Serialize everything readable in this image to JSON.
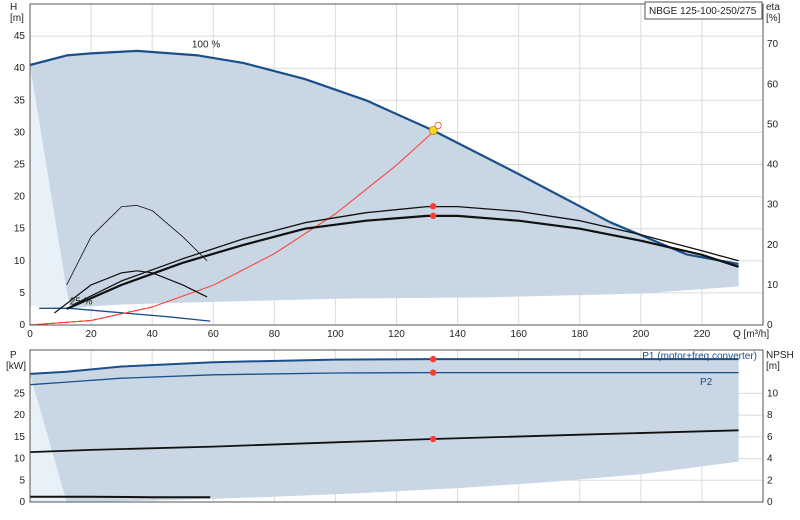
{
  "colors": {
    "envelope": "#c9d6e3",
    "envelope_light": "#e8f0f8",
    "curve_blue": "#1a4f8c",
    "curve_black": "#111111",
    "system_red": "#ff3b30",
    "duty_yellow": "#ffd21f",
    "grid": "#dcdcdc"
  },
  "chart_data": [
    {
      "type": "line",
      "title": "NBGE 125-100-250/275",
      "xlabel": "Q [m³/h]",
      "ylabel": "H [m]",
      "ylabel_unit": "[m]",
      "ylabel_name": "H",
      "y2label_name": "eta",
      "y2label_unit": "[%]",
      "xlim": [
        0,
        240
      ],
      "ylim": [
        0,
        50
      ],
      "y2lim": [
        0,
        80
      ],
      "xticks": [
        0,
        20,
        40,
        60,
        80,
        100,
        120,
        140,
        160,
        180,
        200,
        220
      ],
      "yticks": [
        0,
        5,
        10,
        15,
        20,
        25,
        30,
        35,
        40,
        45
      ],
      "y2ticks": [
        0,
        10,
        20,
        30,
        40,
        50,
        60,
        70
      ],
      "grid": true,
      "annotations": [
        {
          "text": "100 %",
          "x": 53,
          "y": 43.2
        },
        {
          "text": "25 %",
          "x": 13,
          "y": 3.2
        }
      ],
      "envelope": {
        "upper_x": [
          0,
          12,
          20,
          35,
          55,
          70,
          90,
          110,
          132,
          160,
          190,
          215,
          232
        ],
        "upper_y": [
          40.5,
          42,
          42.3,
          42.7,
          42,
          40.8,
          38.3,
          35,
          30.3,
          23.5,
          16,
          11,
          9.5
        ],
        "lower_x": [
          232,
          200,
          150,
          100,
          60,
          30,
          20,
          13
        ],
        "lower_y": [
          6,
          4.9,
          4.3,
          4.1,
          3.6,
          3.2,
          2.9,
          2.6
        ]
      },
      "series": [
        {
          "role": "head_max",
          "x": [
            0,
            12,
            20,
            35,
            55,
            70,
            90,
            110,
            132,
            160,
            190,
            215,
            232
          ],
          "y": [
            40.5,
            42,
            42.3,
            42.7,
            42,
            40.8,
            38.3,
            35,
            30.3,
            23.5,
            16,
            11,
            9.5
          ]
        },
        {
          "role": "head_min",
          "x": [
            3,
            13,
            30,
            45,
            59
          ],
          "y": [
            2.6,
            2.6,
            1.9,
            1.3,
            0.6
          ]
        },
        {
          "role": "system",
          "x": [
            0,
            20,
            40,
            60,
            80,
            100,
            120,
            133
          ],
          "y": [
            0,
            0.7,
            2.8,
            6.2,
            11.1,
            17.3,
            24.9,
            30.5
          ]
        },
        {
          "role": "eta_thin_1",
          "x": [
            12,
            20,
            30,
            35,
            40,
            50,
            58
          ],
          "y2": [
            10,
            22,
            29.5,
            29.8,
            28.5,
            22,
            16
          ]
        },
        {
          "role": "eta_thin_2",
          "x": [
            8,
            20,
            30,
            35,
            40,
            50,
            58
          ],
          "y2": [
            3,
            10,
            13,
            13.5,
            13,
            10,
            7
          ]
        },
        {
          "role": "eta_upper",
          "x": [
            14,
            30,
            50,
            70,
            90,
            110,
            130,
            140,
            160,
            180,
            200,
            220,
            232
          ],
          "y2": [
            5,
            11,
            16.5,
            21.5,
            25.5,
            28,
            29.5,
            29.5,
            28.3,
            26,
            22.5,
            18.5,
            16
          ]
        },
        {
          "role": "eta_lower",
          "x": [
            12,
            30,
            50,
            70,
            90,
            110,
            130,
            140,
            160,
            180,
            200,
            220,
            232
          ],
          "y2": [
            4,
            10,
            15.5,
            20,
            24,
            26,
            27.2,
            27.2,
            26,
            24,
            21,
            17.5,
            14.5
          ]
        }
      ],
      "duty_point": {
        "x": 132,
        "y": 30.3
      },
      "duty_markers_y2": [
        {
          "x": 132,
          "y2": 29.6
        },
        {
          "x": 132,
          "y2": 27.2
        }
      ]
    },
    {
      "type": "line",
      "xlim": [
        0,
        240
      ],
      "ylim": [
        0,
        35
      ],
      "y2lim": [
        0,
        14
      ],
      "ylabel_name": "P",
      "ylabel_unit": "[kW]",
      "y2label_name": "NPSH",
      "y2label_unit": "[m]",
      "yticks": [
        0,
        5,
        10,
        15,
        20,
        25
      ],
      "y2ticks": [
        0,
        2,
        4,
        6,
        8,
        10
      ],
      "grid": true,
      "legend": [
        {
          "text": "P1 (motor+freq.converter)",
          "placement": "top-right"
        },
        {
          "text": "P2",
          "placement": "right"
        }
      ],
      "envelope": {
        "upper_x": [
          0,
          12,
          30,
          60,
          100,
          132,
          180,
          232
        ],
        "upper_y": [
          29.5,
          30,
          31.2,
          32.2,
          32.8,
          32.9,
          32.9,
          32.9
        ],
        "lower_x": [
          232,
          200,
          170,
          140,
          110,
          80,
          50,
          25,
          12
        ],
        "lower_y": [
          9.3,
          6.4,
          4.6,
          3.2,
          2.1,
          1.2,
          0.5,
          0.1,
          0
        ]
      },
      "series": [
        {
          "name": "P1 (motor+freq.converter)",
          "x": [
            0,
            12,
            30,
            60,
            100,
            132,
            180,
            232
          ],
          "y": [
            29.5,
            30,
            31.2,
            32.2,
            32.8,
            32.9,
            32.9,
            32.9
          ]
        },
        {
          "name": "P2",
          "x": [
            0,
            12,
            30,
            60,
            100,
            132,
            180,
            232
          ],
          "y": [
            27,
            27.6,
            28.5,
            29.3,
            29.7,
            29.8,
            29.8,
            29.8
          ]
        },
        {
          "role": "npsh",
          "x": [
            0,
            20,
            60,
            100,
            132,
            180,
            232
          ],
          "y2": [
            4.6,
            4.8,
            5.1,
            5.5,
            5.8,
            6.2,
            6.6
          ]
        },
        {
          "role": "p_min",
          "x": [
            0,
            20,
            40,
            59
          ],
          "y": [
            1.2,
            1.2,
            1.1,
            1.1
          ]
        }
      ],
      "duty_markers": [
        {
          "x": 132,
          "y": 32.9
        },
        {
          "x": 132,
          "y": 29.8
        }
      ],
      "duty_markers_y2": [
        {
          "x": 132,
          "y2": 5.8
        }
      ]
    }
  ]
}
